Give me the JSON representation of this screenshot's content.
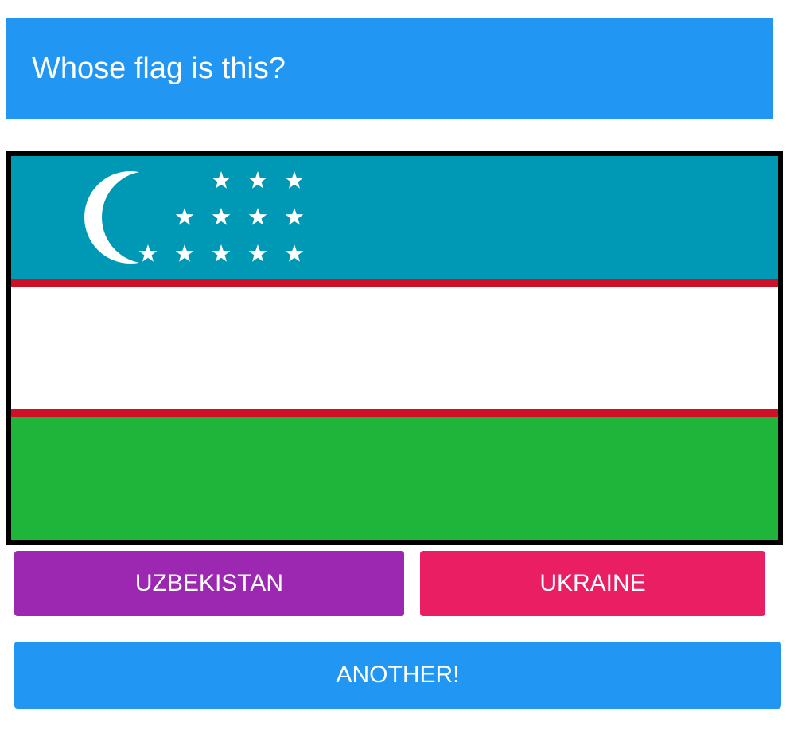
{
  "header": {
    "title": "Whose flag is this?",
    "background": "#2196F3"
  },
  "flag": {
    "icon": "uzbekistan-flag",
    "colors": {
      "blue": "#0099B5",
      "red": "#CE1126",
      "white": "#FFFFFF",
      "green": "#1EB53A"
    }
  },
  "answers": [
    {
      "label": "UZBEKISTAN",
      "color": "#9C27B0"
    },
    {
      "label": "UKRAINE",
      "color": "#E91E63"
    }
  ],
  "another": {
    "label": "ANOTHER!",
    "color": "#2196F3"
  }
}
